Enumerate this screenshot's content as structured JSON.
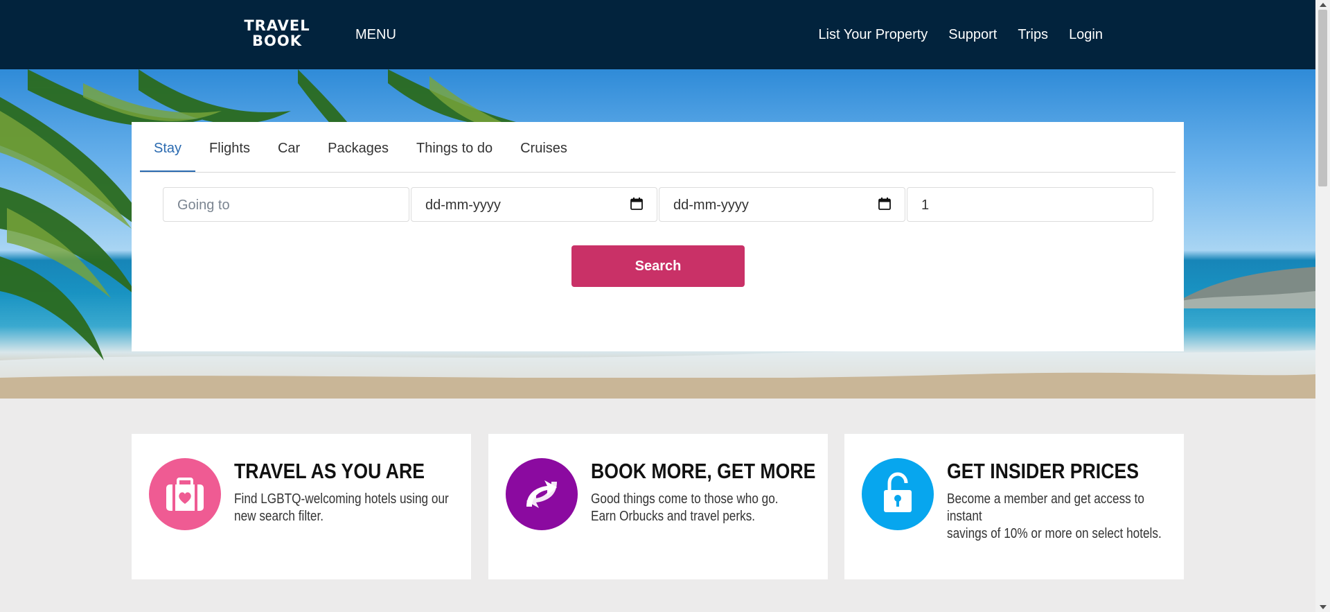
{
  "header": {
    "logo_line1": "TRAVEL",
    "logo_line2": "BOOK",
    "menu": "MENU",
    "nav": [
      "List Your Property",
      "Support",
      "Trips",
      "Login"
    ]
  },
  "search": {
    "tabs": [
      "Stay",
      "Flights",
      "Car",
      "Packages",
      "Things to do",
      "Cruises"
    ],
    "active_tab": "Stay",
    "destination_placeholder": "Going to",
    "checkin_value": "dd-mm-yyyy",
    "checkout_value": "dd-mm-yyyy",
    "travellers_value": "1",
    "button_label": "Search"
  },
  "promos": [
    {
      "title": "TRAVEL AS YOU ARE",
      "line1": "Find LGBTQ-welcoming hotels using our",
      "line2": "new search filter.",
      "icon": "suitcase-heart-icon",
      "color": "#ef5b93"
    },
    {
      "title": "BOOK MORE, GET MORE",
      "line1": "Good things come to those who go.",
      "line2": "Earn Orbucks and travel perks.",
      "icon": "orbucks-arrows-icon",
      "color": "#8b0aa0"
    },
    {
      "title": "GET INSIDER PRICES",
      "line1": "Become a member and get access to instant",
      "line2": "savings of 10% or more on select hotels.",
      "icon": "unlock-icon",
      "color": "#07a6ee"
    }
  ],
  "colors": {
    "header_bg": "#02233d",
    "accent": "#c93167",
    "active_tab": "#2a6ab0"
  }
}
